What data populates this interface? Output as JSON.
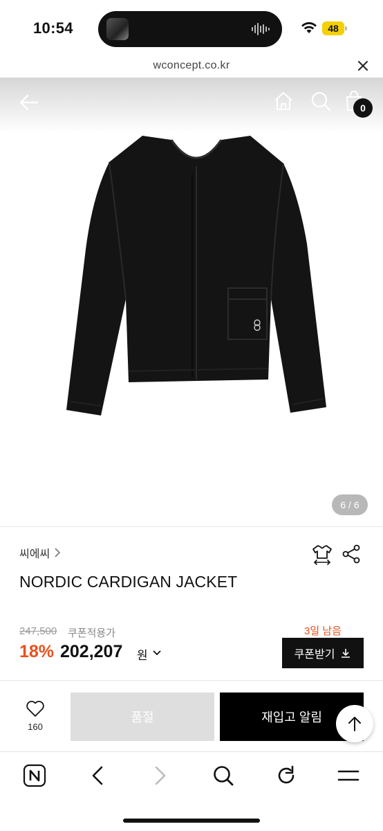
{
  "status_bar": {
    "time": "10:54",
    "battery": "48"
  },
  "browser": {
    "url": "wconcept.co.kr"
  },
  "header": {
    "cart_count": "0"
  },
  "gallery": {
    "indicator": "6 / 6"
  },
  "product": {
    "brand": "씨에씨",
    "name": "NORDIC CARDIGAN JACKET"
  },
  "pricing": {
    "original_price": "247,500",
    "coupon_note": "쿠폰적용가",
    "discount": "18%",
    "sale_price": "202,207",
    "currency": "원",
    "days_left": "3일 남음",
    "coupon_button": "쿠폰받기"
  },
  "purchase": {
    "like_count": "160",
    "soldout_label": "품절",
    "restock_label": "재입고 알림"
  },
  "colors": {
    "accent": "#e8501e",
    "primary": "#000000",
    "battery": "#f4d000"
  }
}
